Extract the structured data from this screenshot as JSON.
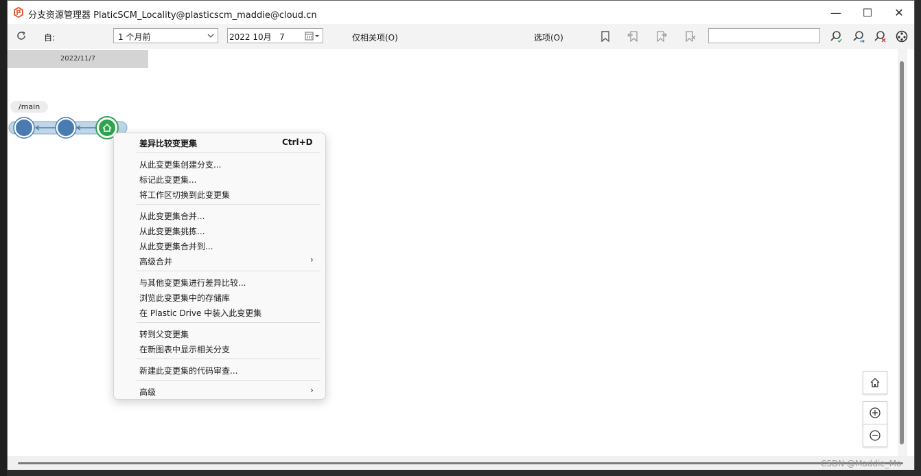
{
  "window": {
    "title": "分支资源管理器 PlaticSCM_Locality@plasticscm_maddie@cloud.cn",
    "controls": {
      "minimize": "—",
      "maximize": "☐",
      "close": "✕"
    }
  },
  "toolbar": {
    "since_label": "自:",
    "range_select": "1 个月前",
    "date_field": "2022 10月   7",
    "related_only": "仅相关项(O)",
    "options": "选项(O)",
    "search_placeholder": ""
  },
  "canvas": {
    "date_header": "2022/11/7",
    "branch": "/main"
  },
  "context_menu": {
    "diff_changeset": "差异比较变更集",
    "diff_shortcut": "Ctrl+D",
    "create_branch": "从此变更集创建分支...",
    "label_changeset": "标记此变更集...",
    "switch_workspace": "将工作区切换到此变更集",
    "merge_from": "从此变更集合并...",
    "cherry_pick": "从此变更集挑拣...",
    "merge_to": "从此变更集合并到...",
    "advanced_merge": "高级合并",
    "diff_with_other": "与其他变更集进行差异比较...",
    "browse_repo": "浏览此变更集中的存储库",
    "plastic_drive": "在 Plastic Drive 中装入此变更集",
    "go_parent": "转到父变更集",
    "show_related": "在新图表中显示相关分支",
    "code_review": "新建此变更集的代码审查...",
    "advanced": "高级",
    "submenu_arrow": "›"
  },
  "watermark": "CSDN @Maddie_Mo",
  "colors": {
    "changeset_blue": "#4a7bb0",
    "changeset_home_green": "#2ea44f",
    "branch_fill": "#bfd6e8"
  }
}
